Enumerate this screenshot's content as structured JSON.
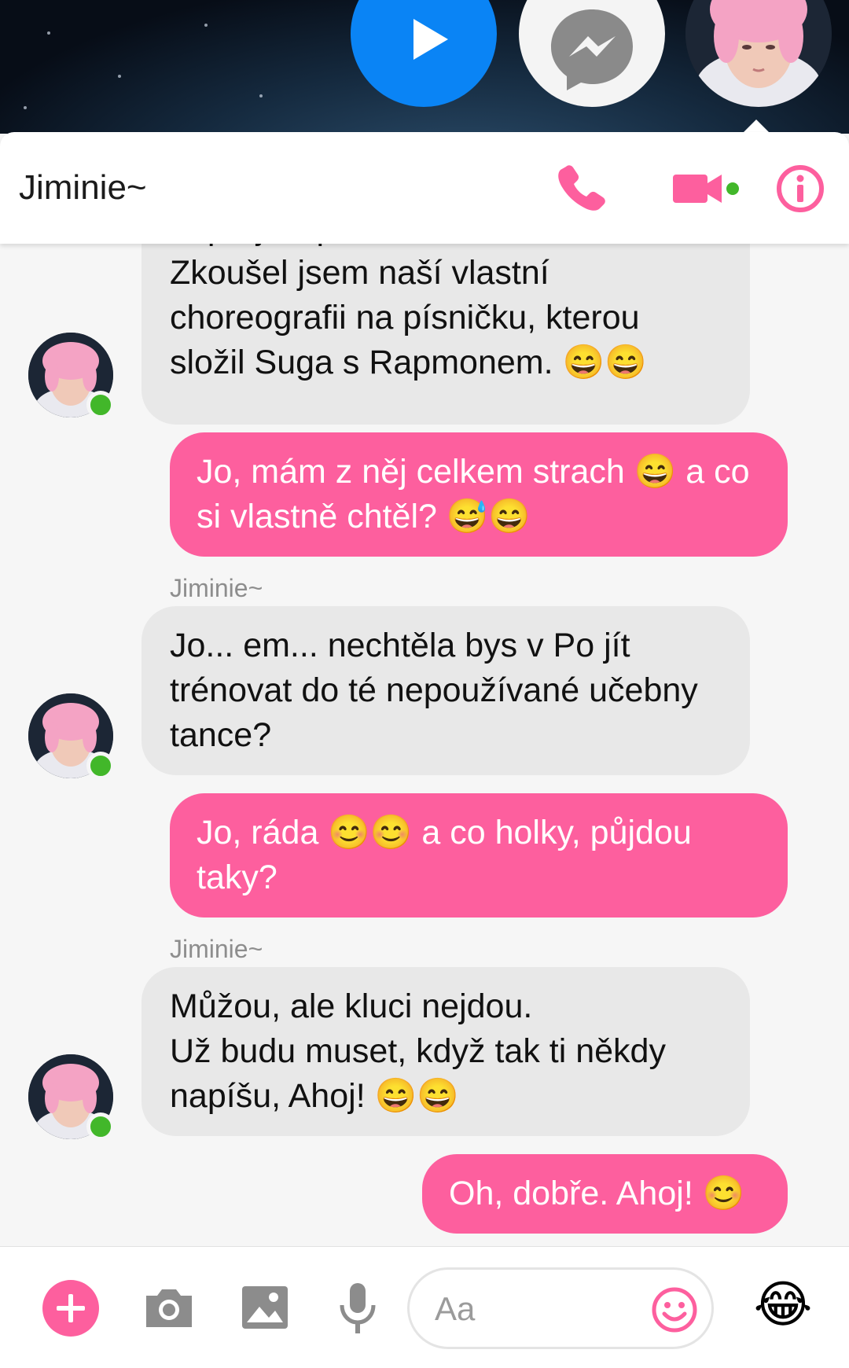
{
  "chat": {
    "title": "Jiminie~",
    "sender_label": "Jiminie~"
  },
  "messages": [
    {
      "from": "them",
      "text": "neprej Rapmona.\nZkoušel jsem naší vlastní choreografii na písničku, kterou složil Suga s Rapmonem. 😄😄"
    },
    {
      "from": "me",
      "text": "Jo, mám z něj celkem strach 😄 a co si vlastně chtěl? 😅😄"
    },
    {
      "from": "them",
      "sender": "Jiminie~",
      "text": "Jo... em... nechtěla bys v Po jít trénovat do té nepoužívané učebny tance?"
    },
    {
      "from": "me",
      "text": "Jo, ráda 😊😊 a co holky, půjdou taky?"
    },
    {
      "from": "them",
      "sender": "Jiminie~",
      "text": "Můžou, ale kluci nejdou.\nUž budu muset, když tak ti někdy napíšu, Ahoj! 😄😄"
    },
    {
      "from": "me",
      "text": "Oh, dobře. Ahoj! 😊"
    }
  ],
  "composer": {
    "placeholder": "Aa",
    "quick_reaction": "😂"
  },
  "icons": {
    "header": [
      "phone-icon",
      "video-camera-icon",
      "info-icon"
    ],
    "composer": [
      "plus-icon",
      "camera-icon",
      "image-icon",
      "microphone-icon",
      "emoji-icon"
    ]
  },
  "colors": {
    "accent": "#fd5f9e",
    "incoming_bubble": "#e8e8e8",
    "online": "#42b72a",
    "play_head": "#0a84f5"
  }
}
